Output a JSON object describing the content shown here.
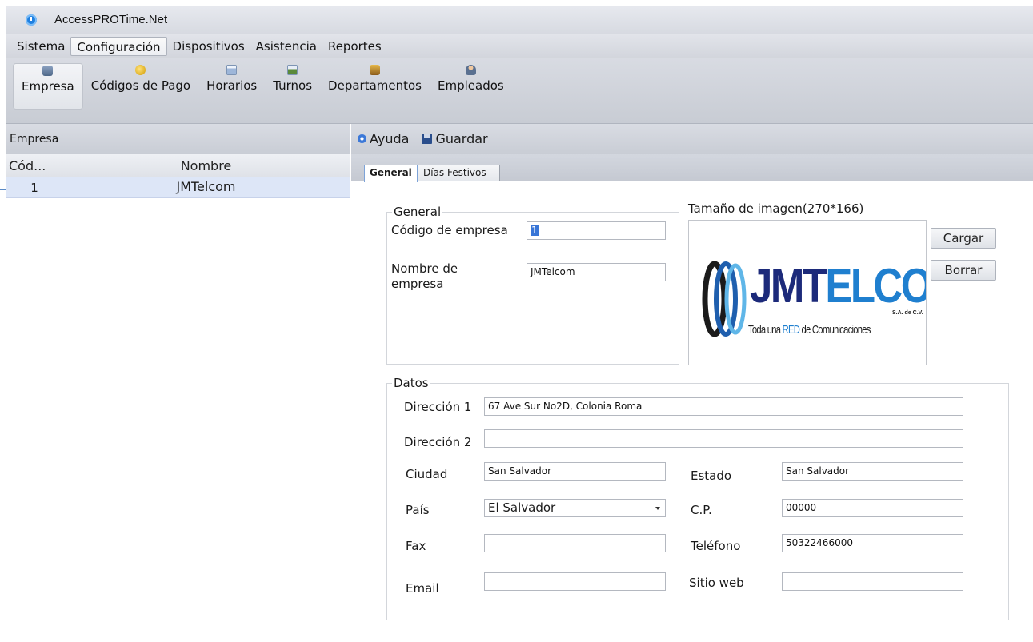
{
  "window": {
    "title": "AccessPROTime.Net"
  },
  "menu": {
    "items": [
      {
        "label": "Sistema",
        "active": false
      },
      {
        "label": "Configuración",
        "active": true
      },
      {
        "label": "Dispositivos",
        "active": false
      },
      {
        "label": "Asistencia",
        "active": false
      },
      {
        "label": "Reportes",
        "active": false
      }
    ]
  },
  "ribbon": {
    "items": [
      {
        "label": "Empresa",
        "icon": "database-icon"
      },
      {
        "label": "Códigos de Pago",
        "icon": "coin-icon"
      },
      {
        "label": "Horarios",
        "icon": "calendar-icon"
      },
      {
        "label": "Turnos",
        "icon": "grid-icon"
      },
      {
        "label": "Departamentos",
        "icon": "box-icon"
      },
      {
        "label": "Empleados",
        "icon": "user-icon"
      }
    ]
  },
  "left": {
    "title": "Empresa",
    "columns": [
      "Cód...",
      "Nombre"
    ],
    "rows": [
      {
        "code": "1",
        "name": "JMTelcom"
      }
    ]
  },
  "toolbar": {
    "help_label": "Ayuda",
    "save_label": "Guardar"
  },
  "tabs": [
    "General",
    "Días Festivos"
  ],
  "general": {
    "legend": "General",
    "company_code_label": "Código de empresa",
    "company_code_value": "1",
    "company_name_label_1": "Nombre de",
    "company_name_label_2": "empresa",
    "company_name_value": "JMTelcom"
  },
  "image": {
    "caption": "Tamaño de imagen(270*166)",
    "load_label": "Cargar",
    "delete_label": "Borrar",
    "logo": {
      "main_a": "JMT",
      "main_b": "ELCOM",
      "sub_a": "Toda una ",
      "sub_b": "RED",
      "sub_c": " de Comunicaciones",
      "suffix": "S.A. de C.V."
    }
  },
  "datos": {
    "legend": "Datos",
    "address1_label": "Dirección 1",
    "address1_value": "67 Ave Sur No2D, Colonia Roma",
    "address2_label": "Dirección 2",
    "address2_value": "",
    "city_label": "Ciudad",
    "city_value": "San Salvador",
    "state_label": "Estado",
    "state_value": "San Salvador",
    "country_label": "País",
    "country_value": "El Salvador",
    "zip_label": "C.P.",
    "zip_value": "00000",
    "fax_label": "Fax",
    "fax_value": "",
    "phone_label": "Teléfono",
    "phone_value": "50322466000",
    "email_label": "Email",
    "email_value": "",
    "web_label": "Sitio web",
    "web_value": ""
  }
}
